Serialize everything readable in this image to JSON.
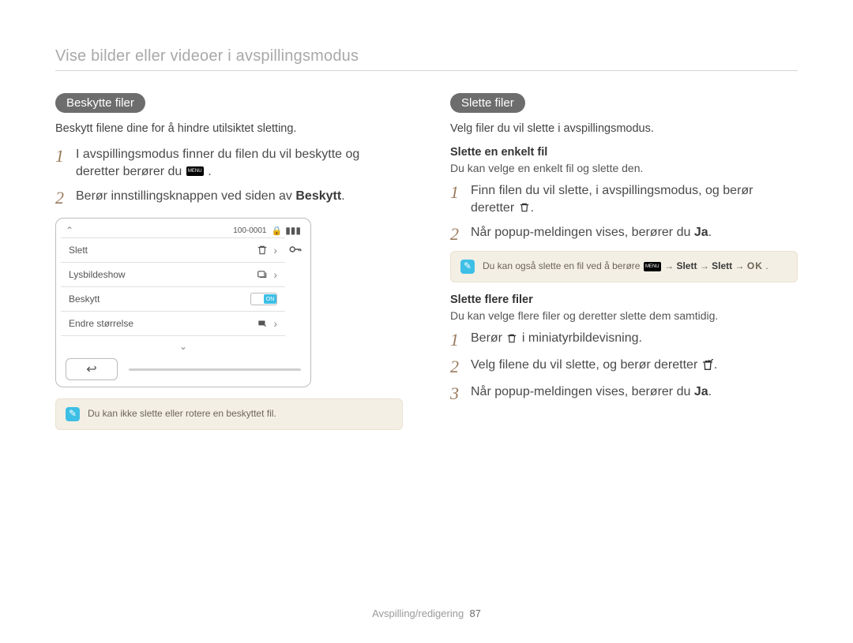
{
  "breadcrumb": "Vise bilder eller videoer i avspillingsmodus",
  "left": {
    "pill": "Beskytte filer",
    "lead": "Beskytt filene dine for å hindre utilsiktet sletting.",
    "step1a": "I avspillingsmodus finner du filen du vil beskytte og deretter berører du ",
    "step1b": ".",
    "step2a": "Berør innstillingsknappen ved siden av ",
    "step2b": "Beskytt",
    "step2c": ".",
    "shot": {
      "counter": "100-0001",
      "items": {
        "0": "Slett",
        "1": "Lysbildeshow",
        "2": "Beskytt",
        "3": "Endre størrelse"
      },
      "on": "ON"
    },
    "note": "Du kan ikke slette eller rotere en beskyttet fil."
  },
  "right": {
    "pill": "Slette filer",
    "lead": "Velg filer du vil slette i avspillingsmodus.",
    "s1_head": "Slette en enkelt fil",
    "s1_text": "Du kan velge en enkelt fil og slette den.",
    "s1_step1a": "Finn filen du vil slette, i avspillingsmodus, og berør deretter ",
    "s1_step1b": ".",
    "s1_step2a": "Når popup-meldingen vises, berører du ",
    "s1_step2b": "Ja",
    "s1_step2c": ".",
    "note1a": "Du kan også slette en fil ved å berøre ",
    "note1b": " → ",
    "note1c": "Slett",
    "note1d": " → ",
    "note1e": "Slett",
    "note1f": " → ",
    "note1g": ".",
    "ok": "OK",
    "s2_head": "Slette flere filer",
    "s2_text": "Du kan velge flere filer og deretter slette dem samtidig.",
    "s2_step1a": "Berør ",
    "s2_step1b": " i miniatyrbildevisning.",
    "s2_step2a": "Velg filene du vil slette, og berør deretter ",
    "s2_step2b": ".",
    "s2_step3a": "Når popup-meldingen vises, berører du ",
    "s2_step3b": "Ja",
    "s2_step3c": "."
  },
  "footer": {
    "section": "Avspilling/redigering",
    "page": "87"
  }
}
